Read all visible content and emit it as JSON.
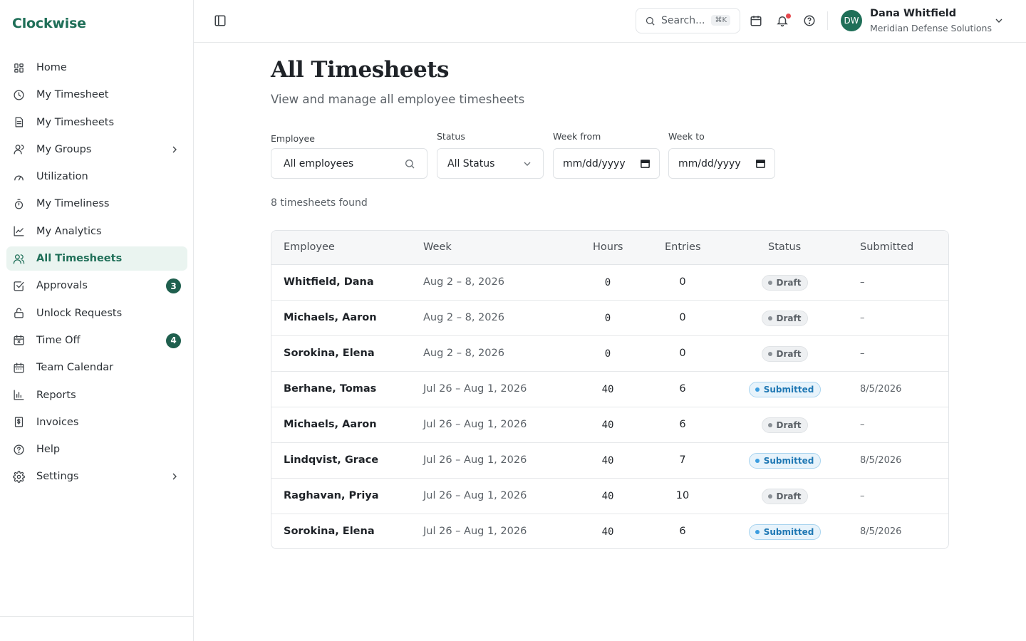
{
  "app": {
    "brand": "Clockwise"
  },
  "sidebar": {
    "items": [
      {
        "label": "Home",
        "icon": "grid-icon"
      },
      {
        "label": "My Timesheet",
        "icon": "clock-icon"
      },
      {
        "label": "My Timesheets",
        "icon": "document-icon"
      },
      {
        "label": "My Groups",
        "icon": "user-icon",
        "chevron": true
      },
      {
        "label": "Utilization",
        "icon": "gauge-icon"
      },
      {
        "label": "My Timeliness",
        "icon": "timer-icon"
      },
      {
        "label": "My Analytics",
        "icon": "chart-line-icon"
      },
      {
        "label": "All Timesheets",
        "icon": "users-icon",
        "active": true
      },
      {
        "label": "Approvals",
        "icon": "check-square-icon",
        "badge": "3"
      },
      {
        "label": "Unlock Requests",
        "icon": "unlock-icon"
      },
      {
        "label": "Time Off",
        "icon": "calendar-x-icon",
        "badge": "4"
      },
      {
        "label": "Team Calendar",
        "icon": "calendar-icon"
      },
      {
        "label": "Reports",
        "icon": "bar-chart-icon"
      },
      {
        "label": "Invoices",
        "icon": "invoice-icon"
      },
      {
        "label": "Help",
        "icon": "help-icon"
      },
      {
        "label": "Settings",
        "icon": "gear-icon",
        "chevron": true
      }
    ]
  },
  "topbar": {
    "search_placeholder": "Search...",
    "search_shortcut": "⌘K",
    "user": {
      "initials": "DW",
      "name": "Dana Whitfield",
      "org": "Meridian Defense Solutions"
    }
  },
  "page": {
    "title": "All Timesheets",
    "subtitle": "View and manage all employee timesheets",
    "count": "8 timesheets found"
  },
  "filters": {
    "employee": {
      "label": "Employee",
      "value": "All employees"
    },
    "status": {
      "label": "Status",
      "value": "All Status"
    },
    "week_from": {
      "label": "Week from",
      "value": "mm/dd/yyyy"
    },
    "week_to": {
      "label": "Week to",
      "value": "mm/dd/yyyy"
    }
  },
  "table": {
    "headers": {
      "employee": "Employee",
      "week": "Week",
      "hours": "Hours",
      "entries": "Entries",
      "status": "Status",
      "submitted": "Submitted"
    },
    "rows": [
      {
        "employee": "Whitfield, Dana",
        "week": "Aug 2 – 8, 2026",
        "hours": "0",
        "entries": "0",
        "status": "Draft",
        "submitted": "–"
      },
      {
        "employee": "Michaels, Aaron",
        "week": "Aug 2 – 8, 2026",
        "hours": "0",
        "entries": "0",
        "status": "Draft",
        "submitted": "–"
      },
      {
        "employee": "Sorokina, Elena",
        "week": "Aug 2 – 8, 2026",
        "hours": "0",
        "entries": "0",
        "status": "Draft",
        "submitted": "–"
      },
      {
        "employee": "Berhane, Tomas",
        "week": "Jul 26 – Aug 1, 2026",
        "hours": "40",
        "entries": "6",
        "status": "Submitted",
        "submitted": "8/5/2026"
      },
      {
        "employee": "Michaels, Aaron",
        "week": "Jul 26 – Aug 1, 2026",
        "hours": "40",
        "entries": "6",
        "status": "Draft",
        "submitted": "–"
      },
      {
        "employee": "Lindqvist, Grace",
        "week": "Jul 26 – Aug 1, 2026",
        "hours": "40",
        "entries": "7",
        "status": "Submitted",
        "submitted": "8/5/2026"
      },
      {
        "employee": "Raghavan, Priya",
        "week": "Jul 26 – Aug 1, 2026",
        "hours": "40",
        "entries": "10",
        "status": "Draft",
        "submitted": "–"
      },
      {
        "employee": "Sorokina, Elena",
        "week": "Jul 26 – Aug 1, 2026",
        "hours": "40",
        "entries": "6",
        "status": "Submitted",
        "submitted": "8/5/2026"
      }
    ]
  },
  "colors": {
    "brand": "#1f6f58",
    "badge": "#1f5f4e",
    "active_bg": "#eaf4f0",
    "submitted": "#1f78b4",
    "notification": "#e5484d"
  }
}
